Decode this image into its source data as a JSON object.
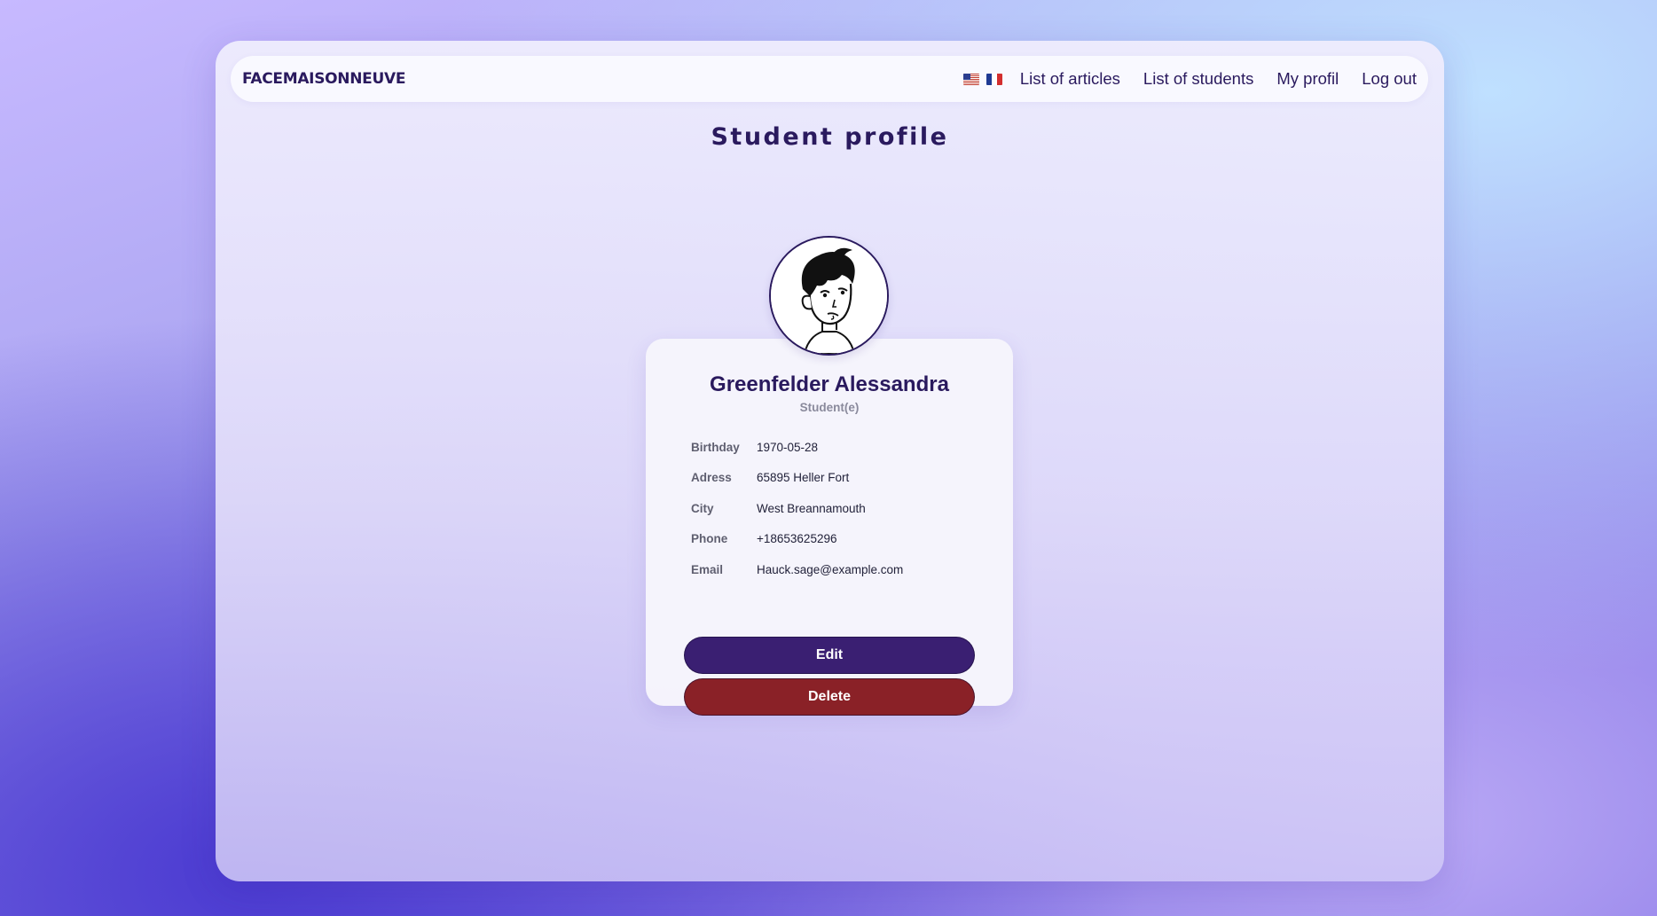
{
  "header": {
    "brand": "FACEMAISONNEUVE",
    "languages": [
      {
        "code": "en",
        "icon": "us-flag-icon"
      },
      {
        "code": "fr",
        "icon": "fr-flag-icon"
      }
    ],
    "nav": {
      "articles": "List of articles",
      "students": "List of students",
      "profile": "My profil",
      "logout": "Log out"
    }
  },
  "page": {
    "title": "Student profile"
  },
  "profile": {
    "avatar_icon": "student-avatar-illustration",
    "name": "Greenfelder Alessandra",
    "role": "Student(e)",
    "fields": [
      {
        "label": "Birthday",
        "value": "1970-05-28"
      },
      {
        "label": "Adress",
        "value": "65895 Heller Fort"
      },
      {
        "label": "City",
        "value": "West Breannamouth"
      },
      {
        "label": "Phone",
        "value": "+18653625296"
      },
      {
        "label": "Email",
        "value": "Hauck.sage@example.com"
      }
    ],
    "actions": {
      "edit": "Edit",
      "delete": "Delete"
    }
  },
  "colors": {
    "primary": "#3a1f72",
    "danger": "#8a2127",
    "text_dark": "#2a1a5e"
  }
}
